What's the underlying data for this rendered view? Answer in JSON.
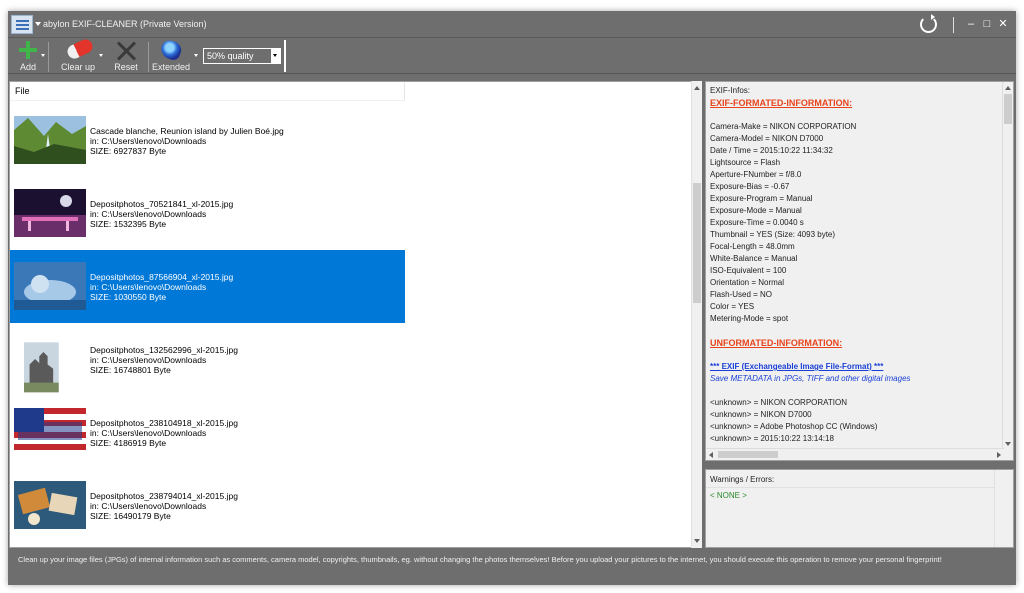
{
  "window": {
    "title": "abylon EXIF-CLEANER (Private Version)"
  },
  "titlebar_controls": {
    "minimize": "–",
    "maximize": "□",
    "close": "✕"
  },
  "toolbar": {
    "add_label": "Add",
    "clear_up_label": "Clear up",
    "reset_label": "Reset",
    "extended_label": "Extended",
    "quality_select_value": "50% quality"
  },
  "file_list": {
    "header": "File",
    "items": [
      {
        "name": "Cascade blanche, Reunion island by Julien Boé.jpg",
        "path": "in: C:\\Users\\lenovo\\Downloads",
        "size": "SIZE: 6927837 Byte",
        "selected": false,
        "thumb_colors": [
          "#6d8f3a",
          "#2f4f1f"
        ]
      },
      {
        "name": "Depositphotos_70521841_xl-2015.jpg",
        "path": "in: C:\\Users\\lenovo\\Downloads",
        "size": "SIZE: 1532395 Byte",
        "selected": false,
        "thumb_colors": [
          "#1b1030",
          "#c25a9a"
        ]
      },
      {
        "name": "Depositphotos_87566904_xl-2015.jpg",
        "path": "in: C:\\Users\\lenovo\\Downloads",
        "size": "SIZE: 1030550 Byte",
        "selected": true,
        "thumb_colors": [
          "#3a78b8",
          "#a7c9e8"
        ]
      },
      {
        "name": "Depositphotos_132562996_xl-2015.jpg",
        "path": "in: C:\\Users\\lenovo\\Downloads",
        "size": "SIZE: 16748801 Byte",
        "selected": false,
        "thumb_colors": [
          "#c9d6e0",
          "#5a5a5a"
        ]
      },
      {
        "name": "Depositphotos_238104918_xl-2015.jpg",
        "path": "in: C:\\Users\\lenovo\\Downloads",
        "size": "SIZE: 4186919 Byte",
        "selected": false,
        "thumb_colors": [
          "#c1272d",
          "#1f3a8a"
        ]
      },
      {
        "name": "Depositphotos_238794014_xl-2015.jpg",
        "path": "in: C:\\Users\\lenovo\\Downloads",
        "size": "SIZE: 16490179 Byte",
        "selected": false,
        "thumb_colors": [
          "#2d5a7a",
          "#d08a3a"
        ]
      }
    ]
  },
  "exif": {
    "label": "EXIF-Infos:",
    "formatted_heading": "EXIF-FORMATED-INFORMATION:",
    "formatted_lines": [
      "Camera-Make = NIKON CORPORATION",
      "Camera-Model = NIKON D7000",
      "Date / Time = 2015:10:22 11:34:32",
      "Lightsource = Flash",
      "Aperture-FNumber = f/8.0",
      "Exposure-Bias = -0.67",
      "Exposure-Program = Manual",
      "Exposure-Mode = Manual",
      "Exposure-Time = 0.0040 s",
      "Thumbnail = YES (Size: 4093 byte)",
      "Focal-Length = 48.0mm",
      "White-Balance = Manual",
      "ISO-Equivalent = 100",
      "Orientation = Normal",
      "Flash-Used = NO",
      "Color = YES",
      "Metering-Mode = spot"
    ],
    "unformatted_heading": "UNFORMATED-INFORMATION:",
    "exif_link": "*** EXIF (Exchangeable Image File-Format) ***",
    "exif_desc": "Save METADATA in JPGs, TIFF and other digital images",
    "unknown_lines": [
      "<unknown> = NIKON CORPORATION",
      "<unknown> = NIKON D7000",
      "<unknown> = Adobe Photoshop CC (Windows)",
      "<unknown> = 2015:10:22 13:14:18"
    ]
  },
  "warnings": {
    "label": "Warnings / Errors:",
    "value": "< NONE >"
  },
  "status": {
    "text": "Clean up your image files (JPGs) of internal information such as comments, camera model, copyrights, thumbnails, eg. without changing the photos themselves! Before you upload your pictures to the internet, you should execute this operation to remove your personal fingerprint!"
  }
}
